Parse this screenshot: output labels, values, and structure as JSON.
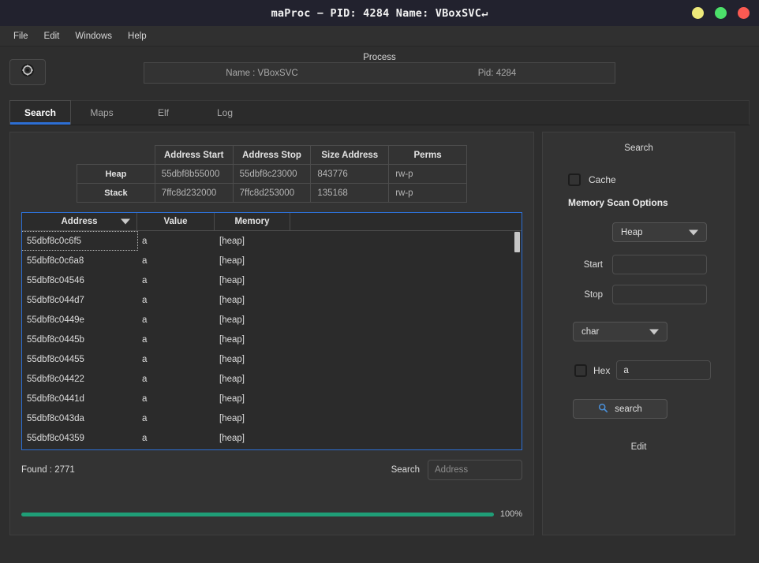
{
  "window": {
    "title": "maProc − PID: 4284 Name: VBoxSVC↵",
    "buttons": [
      {
        "name": "minimize",
        "color": "#ede97a"
      },
      {
        "name": "maximize",
        "color": "#4ce06a"
      },
      {
        "name": "close",
        "color": "#fb5a52"
      }
    ]
  },
  "menubar": {
    "items": [
      {
        "label": "File"
      },
      {
        "label": "Edit"
      },
      {
        "label": "Windows"
      },
      {
        "label": "Help"
      }
    ]
  },
  "process": {
    "section_label": "Process",
    "settings_icon": "gear-icon",
    "name": "Name : VBoxSVC",
    "pid": "Pid: 4284"
  },
  "tabs": [
    {
      "label": "Search",
      "active": true
    },
    {
      "label": "Maps",
      "active": false
    },
    {
      "label": "Elf",
      "active": false
    },
    {
      "label": "Log",
      "active": false
    }
  ],
  "maps_table": {
    "columns": [
      "Address Start",
      "Address Stop",
      "Size Address",
      "Perms"
    ],
    "rows": [
      {
        "label": "Heap",
        "address_start": "55dbf8b55000",
        "address_stop": "55dbf8c23000",
        "size_address": "843776",
        "perms": "rw-p"
      },
      {
        "label": "Stack",
        "address_start": "7ffc8d232000",
        "address_stop": "7ffc8d253000",
        "size_address": "135168",
        "perms": "rw-p"
      }
    ]
  },
  "results_table": {
    "columns": [
      "Address",
      "Value",
      "Memory",
      ""
    ],
    "sort_column": "Address",
    "sort_icon": "chevron-down-icon",
    "rows": [
      {
        "address": "55dbf8c0c6f5",
        "value": "a",
        "memory": "[heap]",
        "focused": true
      },
      {
        "address": "55dbf8c0c6a8",
        "value": "a",
        "memory": "[heap]",
        "focused": false
      },
      {
        "address": "55dbf8c04546",
        "value": "a",
        "memory": "[heap]",
        "focused": false
      },
      {
        "address": "55dbf8c044d7",
        "value": "a",
        "memory": "[heap]",
        "focused": false
      },
      {
        "address": "55dbf8c0449e",
        "value": "a",
        "memory": "[heap]",
        "focused": false
      },
      {
        "address": "55dbf8c0445b",
        "value": "a",
        "memory": "[heap]",
        "focused": false
      },
      {
        "address": "55dbf8c04455",
        "value": "a",
        "memory": "[heap]",
        "focused": false
      },
      {
        "address": "55dbf8c04422",
        "value": "a",
        "memory": "[heap]",
        "focused": false
      },
      {
        "address": "55dbf8c0441d",
        "value": "a",
        "memory": "[heap]",
        "focused": false
      },
      {
        "address": "55dbf8c043da",
        "value": "a",
        "memory": "[heap]",
        "focused": false
      },
      {
        "address": "55dbf8c04359",
        "value": "a",
        "memory": "[heap]",
        "focused": false
      }
    ]
  },
  "status": {
    "found_label": "Found : 2771",
    "search_label": "Search",
    "search_value": "",
    "search_placeholder": "Address"
  },
  "progress": {
    "percent": 100,
    "percent_label": "100%",
    "fill_color": "#1f9e77"
  },
  "search_panel": {
    "title": "Search",
    "cache_label": "Cache",
    "cache_checked": false,
    "scan_options_label": "Memory Scan Options",
    "region_value": "Heap",
    "start_label": "Start",
    "start_value": "",
    "stop_label": "Stop",
    "stop_value": "",
    "type_value": "char",
    "hex_label": "Hex",
    "hex_checked": false,
    "hex_value": "a",
    "search_button_label": "search",
    "search_button_icon": "magnifier-icon",
    "edit_label": "Edit"
  },
  "theme": {
    "accent": "#2d6fd4",
    "titlebar_bg": "#22222e",
    "window_bg": "#2e2e2e",
    "panel_bg": "#333333"
  }
}
